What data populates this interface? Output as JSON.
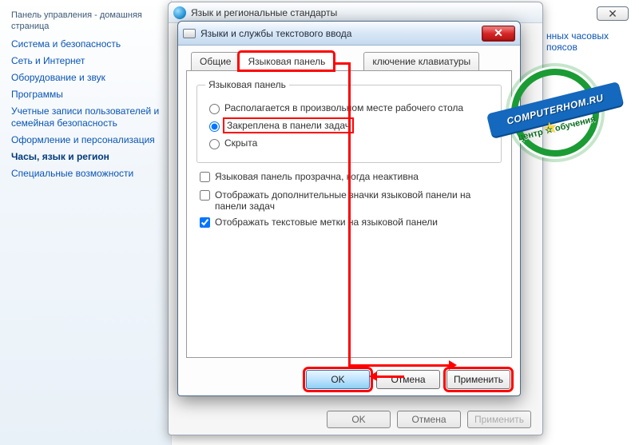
{
  "sidebar": {
    "heading": "Панель управления - домашняя страница",
    "items": [
      "Система и безопасность",
      "Сеть и Интернет",
      "Оборудование и звук",
      "Программы",
      "Учетные записи пользователей и семейная безопасность",
      "Оформление и персонализация",
      "Часы, язык и регион",
      "Специальные возможности"
    ],
    "active_index": 6
  },
  "parent_window": {
    "title": "Язык и региональные стандарты",
    "buttons": {
      "ok": "OK",
      "cancel": "Отмена",
      "apply": "Применить"
    }
  },
  "right_snippet": "нных часовых поясов",
  "dialog": {
    "title": "Языки и службы текстового ввода",
    "tabs": {
      "general": "Общие",
      "lang_panel": "Языковая панель",
      "switch": "ключение клавиатуры"
    },
    "group_label": "Языковая панель",
    "radios": {
      "float": "Располагается в произвольном месте рабочего стола",
      "docked": "Закреплена в панели задач",
      "hidden": "Скрыта"
    },
    "selected_radio": "docked",
    "checks": {
      "transparent": {
        "label": "Языковая панель прозрачна, когда неактивна",
        "checked": false
      },
      "extra_icons": {
        "label": "Отображать дополнительные значки языковой панели на панели задач",
        "checked": false
      },
      "text_labels": {
        "label": "Отображать текстовые метки на языковой панели",
        "checked": true
      }
    },
    "buttons": {
      "ok": "OK",
      "cancel": "Отмена",
      "apply": "Применить"
    }
  },
  "badge": {
    "line1": "COMPUTERHOM.RU",
    "line2": "центр ☆ обучения"
  }
}
